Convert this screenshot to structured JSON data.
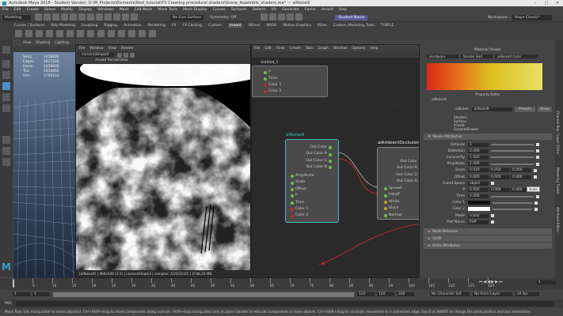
{
  "titlebar": {
    "title": "Autodesk Maya 2018 - Student Version: D:\\M_Projects\\Elements\\Nod_tutorial\\FX Creating procedural shaders\\Scene_Assemble_shaders.ma* --- aiNoise9"
  },
  "menubar": [
    "File",
    "Edit",
    "Create",
    "Select",
    "Modify",
    "Display",
    "Windows",
    "Mesh",
    "Edit Mesh",
    "Mesh Tools",
    "Mesh Display",
    "Curves",
    "Surfaces",
    "Deform",
    "UV",
    "Generate",
    "Cache",
    "Arnold",
    "Help"
  ],
  "statusline": {
    "mode": "Modeling",
    "no_live_surface": "No Live Surface",
    "symmetry": "Symmetry: Off",
    "sign_in": "Student Name",
    "workspace_label": "Workspace :",
    "workspace_value": "Maya Classic*"
  },
  "shelf_tabs": [
    "Curves / Surfaces",
    "Poly Modeling",
    "Sculpting",
    "Rigging",
    "Animation",
    "Rendering",
    "FX",
    "FX Caching",
    "Custom",
    "Arnold",
    "Bifrost",
    "MASH",
    "Motion Graphics",
    "XGen",
    "Custom_Modeling_Tools",
    "TURTLE"
  ],
  "viewport": {
    "menu": [
      "View",
      "Shading",
      "Lighting"
    ],
    "stats": [
      [
        "Verts:",
        "1458600"
      ],
      [
        "Edges:",
        "2917220"
      ],
      [
        "Faces:",
        "1458600"
      ],
      [
        "Tris:",
        "2916864"
      ],
      [
        "UVs:",
        "1793103"
      ]
    ]
  },
  "render_view": {
    "menu": [
      "File",
      "Window",
      "View",
      "Render"
    ],
    "dropdown": "camera\\Shape4",
    "title": "Arnold RenderView",
    "status": "[aiNoise9] | 960x540 (1:1) | cameraShape3 | samples: 2/2/2/2/2/2 | 3748.20 MB"
  },
  "node_editor": {
    "menu": [
      "File",
      "Edit",
      "View",
      "Create",
      "Tabs",
      "Graph",
      "Window",
      "Options",
      "Help"
    ],
    "top_node": {
      "name": "Untitled_1",
      "ports": [
        "P",
        "Time",
        "Color 1",
        "Color 2"
      ]
    },
    "noise_node": {
      "name": "aiNoise9",
      "outputs": [
        "Out Color",
        "Out Color R",
        "Out Color G",
        "Out Color B"
      ],
      "inputs": [
        "Amplitude",
        "Scale",
        "Offset",
        "P",
        "Time",
        "Color 1",
        "Color 2"
      ]
    },
    "ao_node": {
      "name": "aiAmbientOcclusion",
      "outputs": [
        "Out Color",
        "Out Color R",
        "Out Color G",
        "Out Color B"
      ],
      "inputs": [
        "Spread",
        "Falloff",
        "White",
        "Black",
        "Normal"
      ]
    }
  },
  "material_viewer": {
    "title": "Material Viewer",
    "renderer": "Hardware",
    "shape": "Shader Ball",
    "material": "aiNoise9 Color"
  },
  "property_editor": {
    "title": "Property Editor",
    "node_tab": "aiNoise9",
    "name_label": "aiNoise:",
    "name_value": "aiNoise9",
    "presets": "Presets",
    "links": [
      "Show",
      "Hide"
    ],
    "sub_links": [
      "Shaders",
      "Surface",
      "Arnold",
      "GeneralShader"
    ],
    "section": "Noise Attributes",
    "attrs": [
      {
        "label": "Octaves",
        "value": "1"
      },
      {
        "label": "Distortion",
        "value": "0.000"
      },
      {
        "label": "Lacunarity",
        "value": "1.920"
      },
      {
        "label": "Amplitude",
        "value": "1.000"
      },
      {
        "label": "Scale",
        "value": "0.010",
        "v2": "0.050",
        "v3": "0.050"
      },
      {
        "label": "Offset",
        "value": "0.000",
        "v2": "0.000",
        "v3": "0.000"
      },
      {
        "label": "Coord Space",
        "value": "object"
      },
      {
        "label": "P",
        "value": "0.000",
        "v2": "0.000",
        "v3": "0.000"
      },
      {
        "label": "Time",
        "value": "0.000"
      },
      {
        "label": "Color 1",
        "value": ""
      },
      {
        "label": "Color 2",
        "value": ""
      },
      {
        "label": "Mode",
        "value": "scalar"
      },
      {
        "label": "Pref Name",
        "value": "Pref"
      }
    ],
    "tooltip": "Scale",
    "collapsed": [
      "Node Behavior",
      "UUID",
      "Extra Attributes"
    ]
  },
  "right_tabs": [
    "Channel Box / Layer Editor",
    "Modeling Toolkit",
    "Attribute Editor"
  ],
  "timeline": {
    "ticks": [
      "1",
      "5",
      "10",
      "15",
      "20",
      "25",
      "30",
      "35",
      "40",
      "45",
      "50",
      "55",
      "60",
      "65",
      "70",
      "75",
      "80",
      "85",
      "90",
      "95",
      "100",
      "105",
      "110",
      "115",
      "120"
    ],
    "current": "1"
  },
  "range": {
    "start": "1",
    "inner_start": "1",
    "inner_end": "120",
    "end": "120",
    "end2": "200",
    "character_set": "No Character Set",
    "anim_layer": "No Anim Layer",
    "fps": "24 fps"
  },
  "mel": "MEL",
  "help_line": "Move Tool: Use manipulator to move object(s). Ctrl+Shift+drag to move components along normals. Shift+drag manipulator axis or plane handles to extrude components or clone objects. Ctrl+Shift+drag to constrain movement to a connected edge. Use D or INSERT to change the pivot position and axis orientation.",
  "colors": {
    "accent": "#4a90c6",
    "noise_border": "#4bbfc2",
    "wire_red": "#c82a2a",
    "ramp_start": "#d92a1a",
    "ramp_end": "#e8e060"
  }
}
